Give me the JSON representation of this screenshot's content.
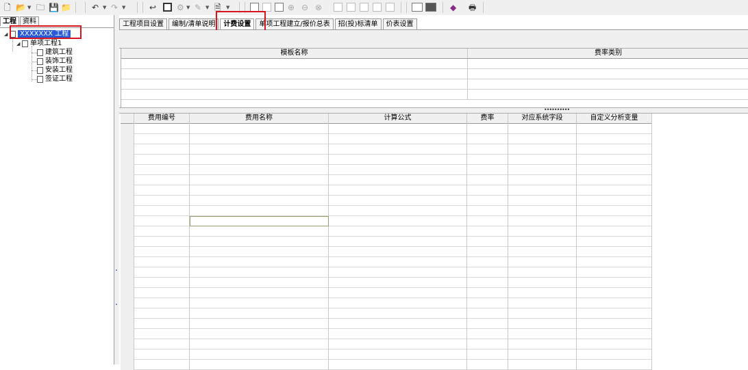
{
  "toolbar": {
    "icons": [
      "new-file-icon",
      "open-folder-icon",
      "folder-icon",
      "save-icon",
      "export-icon",
      "undo-icon",
      "redo-icon",
      "back-arrow-icon",
      "tree-view-icon",
      "tool-icon",
      "edit-icon",
      "page-icon",
      "layout-left-icon",
      "layout-full-icon",
      "layout-right-icon",
      "add-circle-icon",
      "remove-circle-icon",
      "options-circle-icon",
      "row-insert-icon",
      "row-delete-icon",
      "row-up-icon",
      "row-down-icon",
      "list-view-icon",
      "grid-view-icon",
      "book-icon",
      "print-icon"
    ]
  },
  "left_panel": {
    "tabs": [
      "工程",
      "资料"
    ],
    "active_tab": "工程",
    "tree": {
      "root": "XXXXXXX 工程",
      "child": "单项工程1",
      "leaves": [
        "建筑工程",
        "装饰工程",
        "安装工程",
        "签证工程"
      ]
    }
  },
  "tabs": [
    "工程项目设置",
    "编制/清单说明",
    "计费设置",
    "单项工程建立/报价总表",
    "招(投)标清单",
    "价表设置"
  ],
  "active_tab": "计费设置",
  "template_grid": {
    "columns": [
      "模板名称",
      "费率类别"
    ],
    "rows": 4
  },
  "fee_grid": {
    "columns": [
      "费用编号",
      "费用名称",
      "计算公式",
      "费率",
      "对应系统字段",
      "自定义分析变量"
    ],
    "rows": 24
  },
  "colors": {
    "highlight": "#d8141c",
    "selection": "#2a5bd7"
  }
}
